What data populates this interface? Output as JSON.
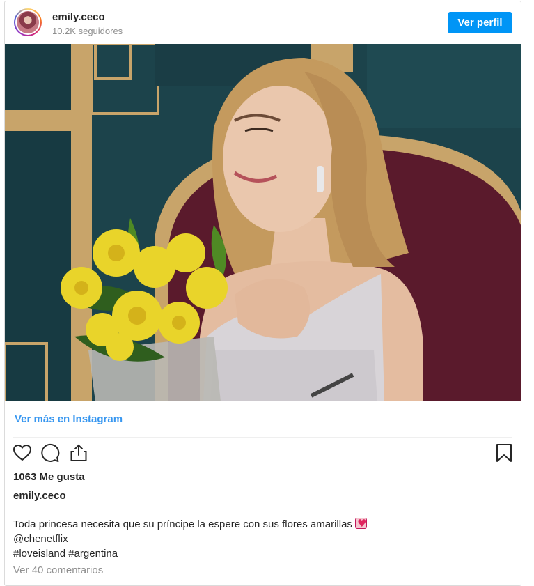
{
  "header": {
    "username": "emily.ceco",
    "followers": "10.2K seguidores",
    "profile_button": "Ver perfil"
  },
  "post": {
    "image_alt_icon": "photo-of-woman-holding-yellow-lilies",
    "view_more": "Ver más en Instagram",
    "likes": "1063 Me gusta",
    "caption_user": "emily.ceco",
    "caption_line_1": "Toda princesa necesita que su príncipe la espere con sus flores amarillas",
    "caption_line_2": "@chenetflix",
    "caption_line_3": "#loveisland #argentina",
    "view_comments": "Ver 40 comentarios"
  },
  "icons": {
    "like": "heart-icon",
    "comment": "comment-icon",
    "share": "share-icon",
    "save": "bookmark-icon",
    "caption_emoji": "heart-emoji-icon"
  },
  "colors": {
    "accent": "#0095f6",
    "link": "#3897f0",
    "muted": "#8e8e8e",
    "text": "#262626"
  }
}
